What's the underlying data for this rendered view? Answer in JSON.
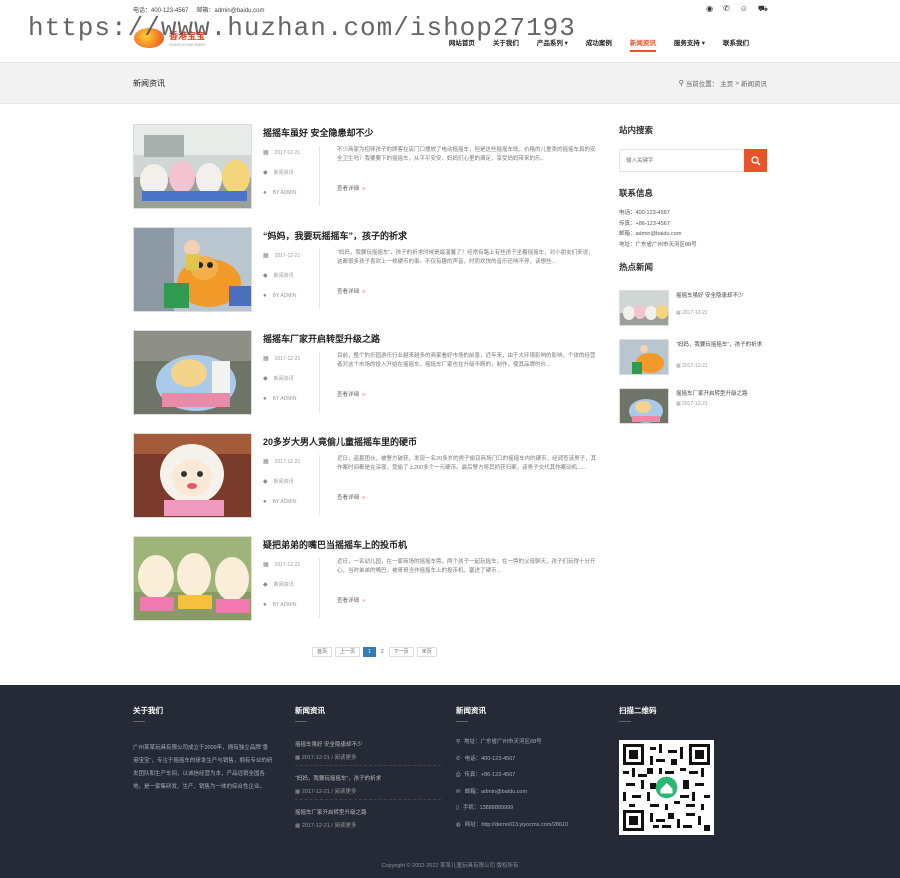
{
  "header": {
    "phone": "电话：400-123-4567",
    "email": "邮箱：admin@baidu.com",
    "watermark": "https://www.huzhan.com/ishop27193",
    "logo_text": "香港宝宝",
    "logo_sub": "HONG KONG BABY",
    "social_icons": [
      "weibo-icon",
      "wechat-icon",
      "qq-icon",
      "cart-icon"
    ],
    "nav": [
      {
        "label": "网站首页",
        "active": false
      },
      {
        "label": "关于我们",
        "active": false
      },
      {
        "label": "产品系列 ▾",
        "active": false
      },
      {
        "label": "成功案例",
        "active": false
      },
      {
        "label": "新闻资讯",
        "active": true
      },
      {
        "label": "服务支持 ▾",
        "active": false
      },
      {
        "label": "联系我们",
        "active": false
      }
    ]
  },
  "band": {
    "title": "新闻资讯",
    "crumb_prefix": "当前位置：",
    "crumb_home": "主页",
    "crumb_sep": " > ",
    "crumb_current": "新闻资讯"
  },
  "articles": [
    {
      "title": "摇摇车虽好 安全隐患却不少",
      "date": "2017-12-21",
      "category": "新闻资讯",
      "author": "BY ADMIN",
      "excerpt": "不少商家为招徕孩子的顾客在店门口摆放了电动摇摇车，但是这些摇摇车既，价格的儿童类的摇摇车真的安全卫生吗？我要要下的摇摇车，从平平安安、妈妈们心里的满足，享受妈妈带来的乐。",
      "readmore": "查看详细"
    },
    {
      "title": "“妈妈，我要玩摇摇车”，孩子的祈求",
      "date": "2017-12-21",
      "category": "新闻资讯",
      "author": "BY ADMIN",
      "excerpt": "“妈妈，我要玩摇摇车”，孩子的祈求时候是最温馨了？经常有路上有些孩子坐着摇摇车，对小朋友们来说，这都很多孩子喜欢上一枚硬币的事。不仅有趣的声音，时而欢快的音乐还响不停，该想些...",
      "readmore": "查看详细"
    },
    {
      "title": "摇摇车厂家开启转型升级之路",
      "date": "2017-12-21",
      "category": "新闻资讯",
      "author": "BY ADMIN",
      "excerpt": "目前，整个的乐园游乐行业越来越多的商家看好市场的前景，近年来，由于大环境影响的影响，个体的经营者对这个市场的投入开始在摇摇车，摇摇车厂家也在升级不断的，制作，使其品牌的价...",
      "readmore": "查看详细"
    },
    {
      "title": "20多岁大男人竟偷儿童摇摇车里的硬币",
      "date": "2017-12-21",
      "category": "新闻资讯",
      "author": "BY ADMIN",
      "excerpt": "近日，盗墓团伙，被警方破获，发现一名20多岁的男子偷窃商场门口的摇摇车内的硬币，经调查该男子，其作案时间都是在深夜，竟偷了上200多个一元硬币。最后警方将其抓获归案，该男子交代其作案动机......",
      "readmore": "查看详细"
    },
    {
      "title": "疑把弟弟的嘴巴当摇摇车上的投币机",
      "date": "2017-12-21",
      "category": "新闻资讯",
      "author": "BY ADMIN",
      "excerpt": "近日，一名幼儿园，在一家商场的摇摇车旁，两个孩子一起玩摇车，在一旁的父母聊天，孩子们玩得十分开心，当时弟弟的嘴巴，被哥哥当作摇摇车上的投币机，塞进了硬币...",
      "readmore": "查看详细"
    }
  ],
  "pagination": {
    "first": "首页",
    "prev": "上一页",
    "pages": [
      "1",
      "2"
    ],
    "current": "1",
    "next": "下一页",
    "last": "末页"
  },
  "sidebar": {
    "search_title": "站内搜索",
    "search_placeholder": "输入关键字",
    "contact_title": "联系信息",
    "contact": [
      "电话：400-123-4567",
      "传真：+86-123-4567",
      "邮箱：admin@baidu.com",
      "地址：广东省广州市天河区88号"
    ],
    "hot_title": "热点新闻",
    "hot": [
      {
        "title": "摇摇车虽好 安全隐患却不少",
        "date": "2017-12-21"
      },
      {
        "title": "“妈妈，我要玩摇摇车”，孩子的祈求",
        "date": "2017-12-21"
      },
      {
        "title": "摇摇车厂家开启转型升级之路",
        "date": "2017-12-21"
      }
    ]
  },
  "footer": {
    "about_title": "关于我们",
    "about_text": "广州某某玩具有限公司成立于2009年，拥有独立品牌“香港宝宝”，专注于摇摇车的研发生产与销售，拥有专业的研发团队和生产车间，以诚信经营为本，产品远销全国各地，是一家集研发、生产、销售为一体的综合性企业。",
    "news_title": "新闻资讯",
    "news": [
      {
        "title": "摇摇车虽好 安全隐患却不少",
        "date": "2017-12-21 / 阅读更多"
      },
      {
        "title": "“妈妈，我要玩摇摇车”，孩子的祈求",
        "date": "2017-12-21 / 阅读更多"
      },
      {
        "title": "摇摇车厂家开启转型升级之路",
        "date": "2017-12-21 / 阅读更多"
      }
    ],
    "contact_title": "新闻资讯",
    "contact": [
      {
        "icon": "location-icon",
        "text": "地址：广东省广州市天河区88号"
      },
      {
        "icon": "phone-icon",
        "text": "电话：400-123-4567"
      },
      {
        "icon": "fax-icon",
        "text": "传真：+86-123-4567"
      },
      {
        "icon": "mail-icon",
        "text": "邮箱：admin@baidu.com"
      },
      {
        "icon": "mobile-icon",
        "text": "手机：13888889999"
      },
      {
        "icon": "globe-icon",
        "text": "网址：http://demo013.yiyocms.com/28610"
      }
    ],
    "qr_title": "扫描二维码",
    "copyright": "Copyright © 2002-2022 某某儿童玩具有限公司 版权所有"
  }
}
